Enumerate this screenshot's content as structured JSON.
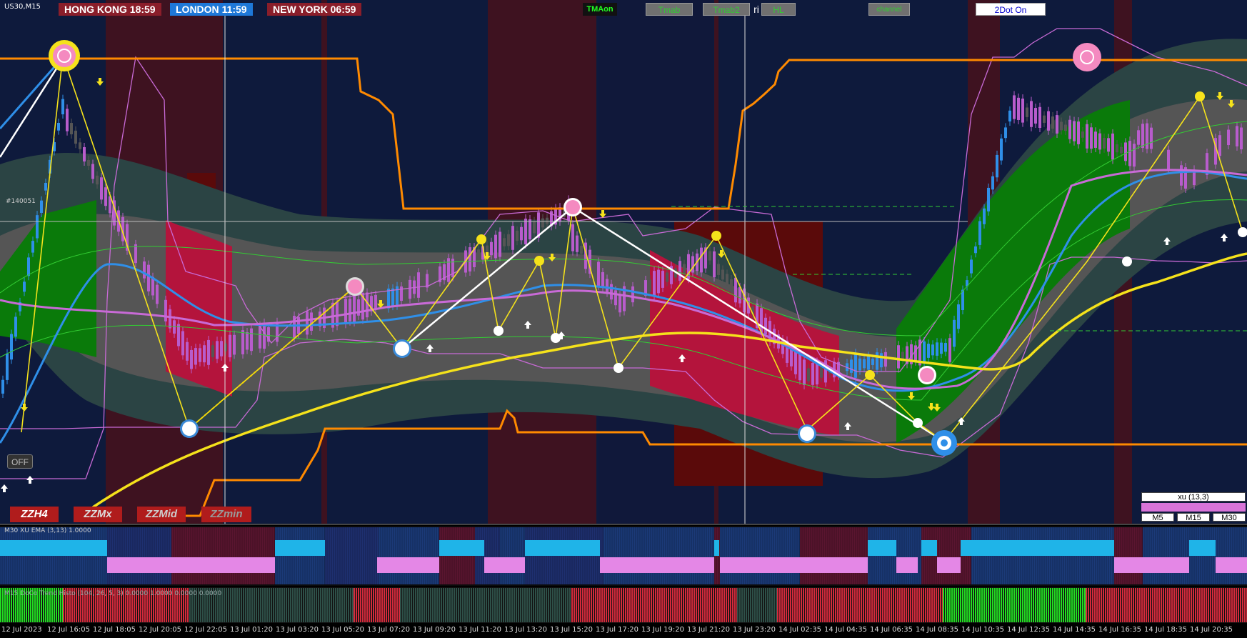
{
  "symbol": "US30,M15",
  "clocks": [
    {
      "city": "HONG KONG",
      "time": "18:59"
    },
    {
      "city": "LONDON",
      "time": "11:59"
    },
    {
      "city": "NEW YORK",
      "time": "06:59"
    }
  ],
  "top_buttons": {
    "tmaon": "TMAon",
    "tmab": "Tmab",
    "tmab2": "Tmab2",
    "hl": "HL",
    "channel": "channel",
    "twodot": "2Dot On",
    "ri": "ri"
  },
  "price_marker": "#140051",
  "off_button": "OFF",
  "zz_buttons": [
    "ZZH4",
    "ZZMx",
    "ZZMid",
    "ZZmin"
  ],
  "xu_panel": {
    "title": "xu (13,3)",
    "tfs": [
      "M5",
      "M15",
      "M30"
    ]
  },
  "indicator1_label": "M30 XU EMA (3,13) 1.0000",
  "indicator2_label": "M15 DoCo Trend Histo (104, 26, 5, 3) 0.0000 1.0000 0.0000 0.0000",
  "x_axis_labels": [
    "12 Jul 2023",
    "12 Jul 16:05",
    "12 Jul 18:05",
    "12 Jul 20:05",
    "12 Jul 22:05",
    "13 Jul 01:20",
    "13 Jul 03:20",
    "13 Jul 05:20",
    "13 Jul 07:20",
    "13 Jul 09:20",
    "13 Jul 11:20",
    "13 Jul 13:20",
    "13 Jul 15:20",
    "13 Jul 17:20",
    "13 Jul 19:20",
    "13 Jul 21:20",
    "13 Jul 23:20",
    "14 Jul 02:35",
    "14 Jul 04:35",
    "14 Jul 06:35",
    "14 Jul 08:35",
    "14 Jul 10:35",
    "14 Jul 12:35",
    "14 Jul 14:35",
    "14 Jul 16:35",
    "14 Jul 18:35",
    "14 Jul 20:35"
  ],
  "colors": {
    "bg_navy": "#0e1a3c",
    "bg_maroon": "#3e1220",
    "orange": "#ff8a00",
    "yellow": "#f5e21b",
    "blue_ma": "#2f8fe8",
    "violet": "#c86ad6",
    "band_gray": "#555555",
    "band_dark": "#2b4444",
    "green_zone": "#0a7a0a",
    "red_zone": "#b4143c",
    "cyan_bar": "#1fb4e8",
    "pink_bar": "#e487e6",
    "histo_green": "#22dd22",
    "histo_red": "#d42a3c",
    "histo_dark": "#2e5048"
  }
}
